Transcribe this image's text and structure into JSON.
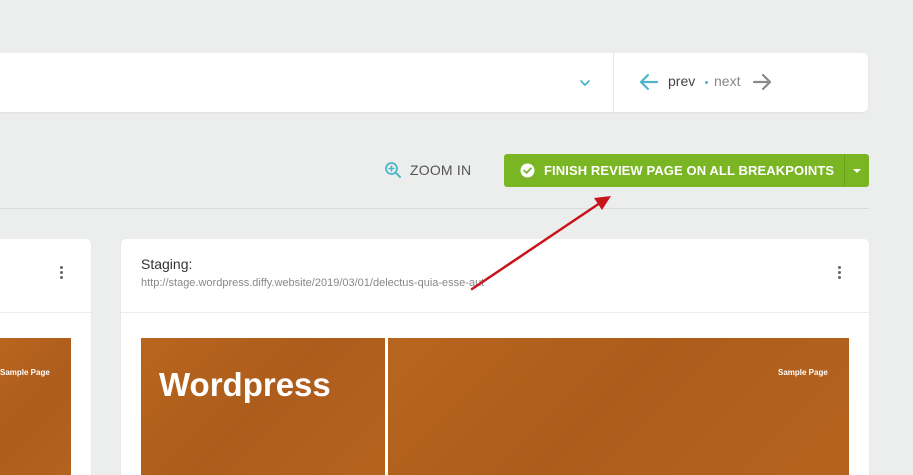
{
  "nav": {
    "prev_label": "prev",
    "next_label": "next"
  },
  "toolbar": {
    "zoom_label": "ZOOM IN",
    "finish_label": "FINISH REVIEW PAGE ON ALL BREAKPOINTS"
  },
  "panels": {
    "left": {
      "screenshot_menu": "Sample Page"
    },
    "right": {
      "title": "Staging:",
      "url": "http://stage.wordpress.diffy.website/2019/03/01/delectus-quia-esse-aut",
      "screenshot_brand": "Wordpress",
      "screenshot_menu": "Sample Page"
    }
  },
  "colors": {
    "accent_teal": "#4fb6c9",
    "finish_green": "#7ab523",
    "screenshot_orange": "#b5621f",
    "annotation_red": "#c8141b"
  },
  "icons": {
    "dropdown": "chevron-down-icon",
    "prev": "arrow-left-icon",
    "next": "arrow-right-icon",
    "zoom": "zoom-in-icon",
    "finish": "check-circle-icon",
    "finish_menu": "caret-down-icon",
    "panel_menu": "kebab-menu-icon"
  }
}
